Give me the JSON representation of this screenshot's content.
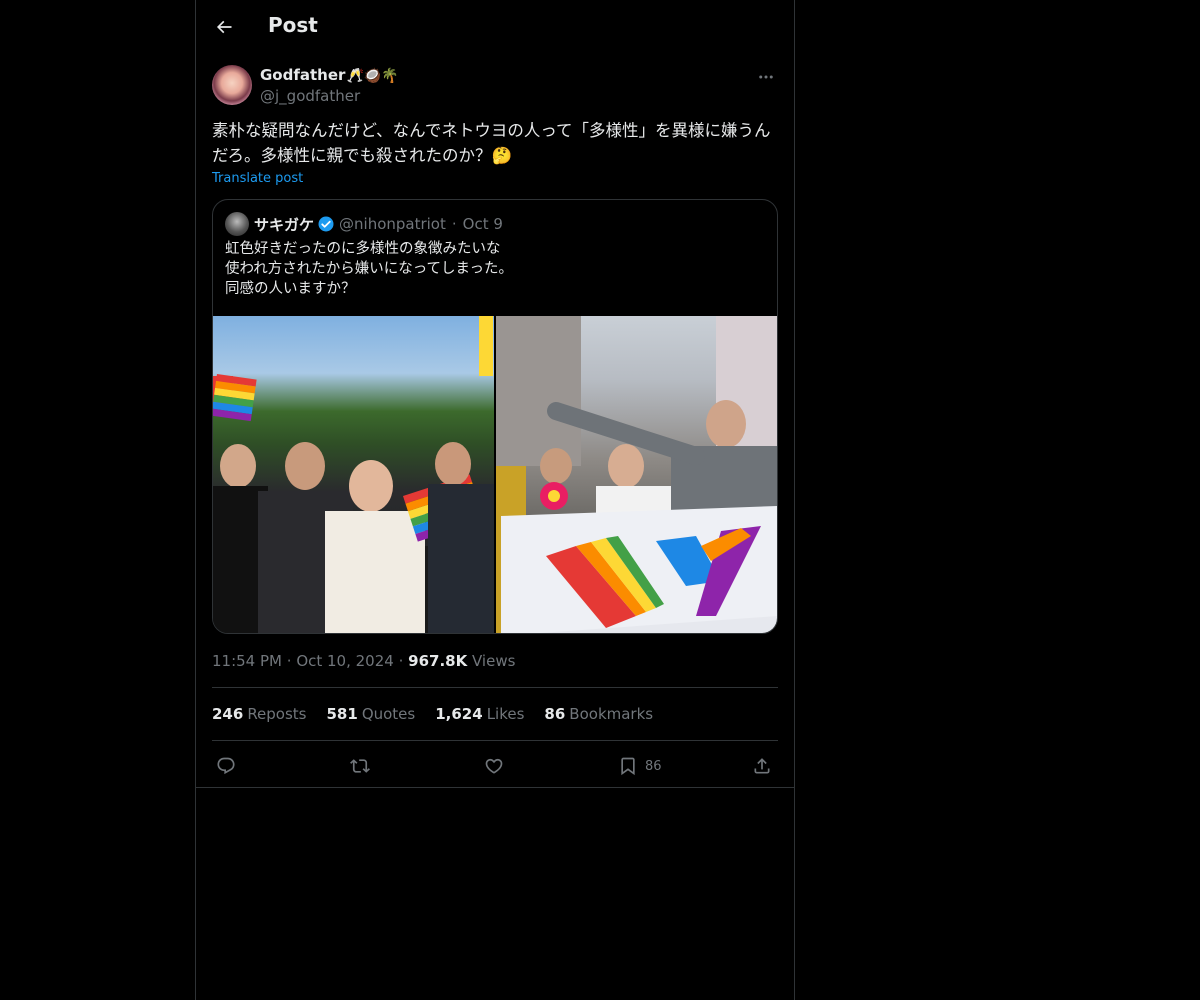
{
  "header": {
    "title": "Post"
  },
  "post": {
    "author_name": "Godfather",
    "author_emojis": "🥂🥥🌴",
    "handle": "@j_godfather",
    "text": "素朴な疑問なんだけど、なんでネトウヨの人って「多様性」を異様に嫌うんだろ。多様性に親でも殺されたのか？🤔",
    "translate_label": "Translate post",
    "time": "11:54 PM",
    "date": "Oct 10, 2024",
    "views_count": "967.8K",
    "views_label": "Views"
  },
  "quote": {
    "name": "サキガケ",
    "handle": "@nihonpatriot",
    "date": "Oct 9",
    "text": "虹色好きだったのに多様性の象徴みたいな\n使われ方されたから嫌いになってしまった。\n同感の人いますか？"
  },
  "stats": {
    "reposts_count": "246",
    "reposts_label": "Reposts",
    "quotes_count": "581",
    "quotes_label": "Quotes",
    "likes_count": "1,624",
    "likes_label": "Likes",
    "bookmarks_count": "86",
    "bookmarks_label": "Bookmarks"
  },
  "actions": {
    "bookmark_count": "86"
  },
  "colors": {
    "accent": "#1d9bf0",
    "muted": "#71767b",
    "border": "#2f3336",
    "background": "#000000"
  }
}
